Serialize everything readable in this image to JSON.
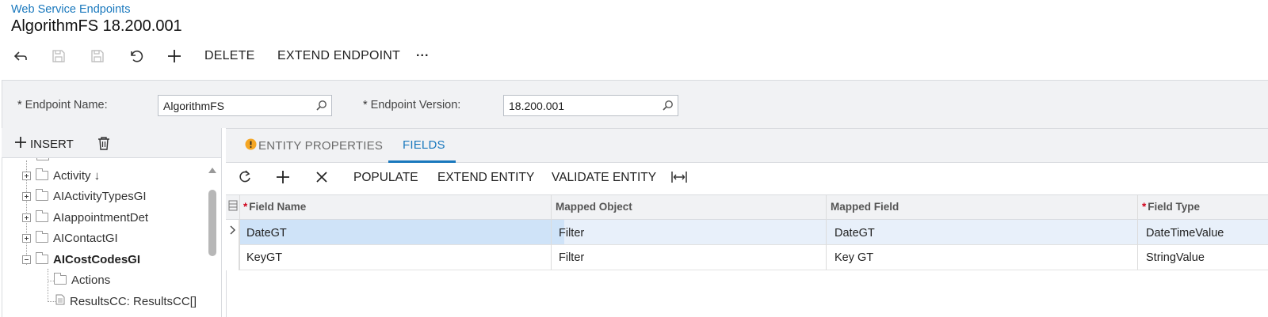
{
  "breadcrumb": "Web Service Endpoints",
  "title": "AlgorithmFS 18.200.001",
  "toolbar": {
    "delete_label": "DELETE",
    "extend_endpoint_label": "EXTEND ENDPOINT",
    "more_label": "···"
  },
  "summary": {
    "endpoint_name_label": "Endpoint Name:",
    "endpoint_name_value": "AlgorithmFS",
    "endpoint_version_label": "Endpoint Version:",
    "endpoint_version_value": "18.200.001",
    "required_mark": "*"
  },
  "tree": {
    "insert_label": "INSERT",
    "items": [
      {
        "label": "Activity ↓",
        "bold": false
      },
      {
        "label": "AIActivityTypesGI",
        "bold": false
      },
      {
        "label": "AIappointmentDet",
        "bold": false
      },
      {
        "label": "AIContactGI",
        "bold": false
      },
      {
        "label": "AICostCodesGI",
        "bold": true
      },
      {
        "label": "Actions",
        "bold": false
      },
      {
        "label": "ResultsCC: ResultsCC[]",
        "bold": false
      }
    ]
  },
  "tabs": [
    {
      "label": "ENTITY PROPERTIES"
    },
    {
      "label": "FIELDS"
    }
  ],
  "grid_toolbar": {
    "populate_label": "POPULATE",
    "extend_entity_label": "EXTEND ENTITY",
    "validate_entity_label": "VALIDATE ENTITY"
  },
  "grid": {
    "columns": [
      "Field Name",
      "Mapped Object",
      "Mapped Field",
      "Field Type"
    ],
    "rows": [
      [
        "DateGT",
        "Filter",
        "DateGT",
        "DateTimeValue"
      ],
      [
        "KeyGT",
        "Filter",
        "Key GT",
        "StringValue"
      ]
    ]
  },
  "colors": {
    "accent": "#1978bd",
    "required": "#d0021b",
    "warning": "#f5a623"
  }
}
